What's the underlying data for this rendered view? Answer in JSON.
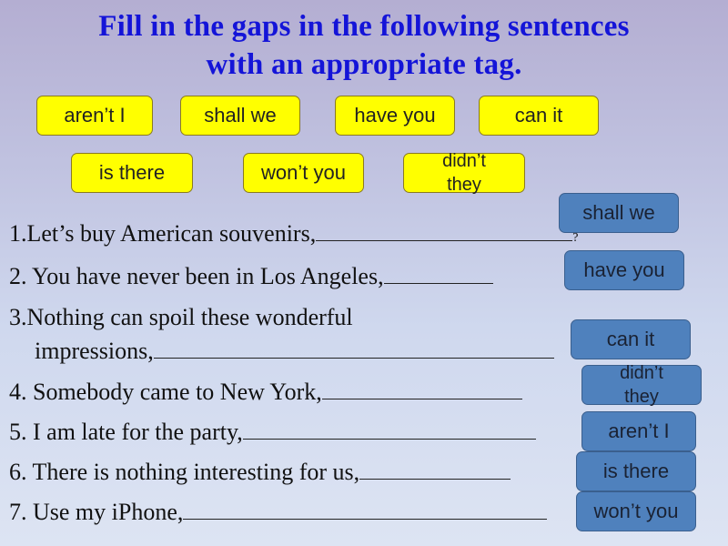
{
  "title": {
    "line1": "Fill in the gaps in the following sentences",
    "line2": "with an appropriate tag."
  },
  "options": [
    {
      "label": "aren’t I"
    },
    {
      "label": "shall we"
    },
    {
      "label": "have you"
    },
    {
      "label": "can it"
    },
    {
      "label": "is there"
    },
    {
      "label": "won’t you"
    },
    {
      "label": "didn’t they"
    }
  ],
  "sentences": [
    {
      "text": "1.Let’s buy American souvenirs,",
      "end": "?"
    },
    {
      "text": "2. You have never been in Los Angeles,"
    },
    {
      "text": "3.Nothing can spoil these wonderful",
      "text2": "impressions,"
    },
    {
      "text": "4. Somebody came to New York,"
    },
    {
      "text": "5. I am late for the party,"
    },
    {
      "text": "6. There is nothing interesting for us,"
    },
    {
      "text": "7. Use my iPhone,"
    }
  ],
  "answers": [
    {
      "label": "shall we"
    },
    {
      "label": "have you"
    },
    {
      "label": "can it"
    },
    {
      "label": "didn’t they"
    },
    {
      "label": "aren’t I"
    },
    {
      "label": "is there"
    },
    {
      "label": "won’t you"
    }
  ],
  "colors": {
    "title": "#1414d8",
    "option_fill": "#ffff00",
    "answer_fill": "#4f81bd"
  }
}
